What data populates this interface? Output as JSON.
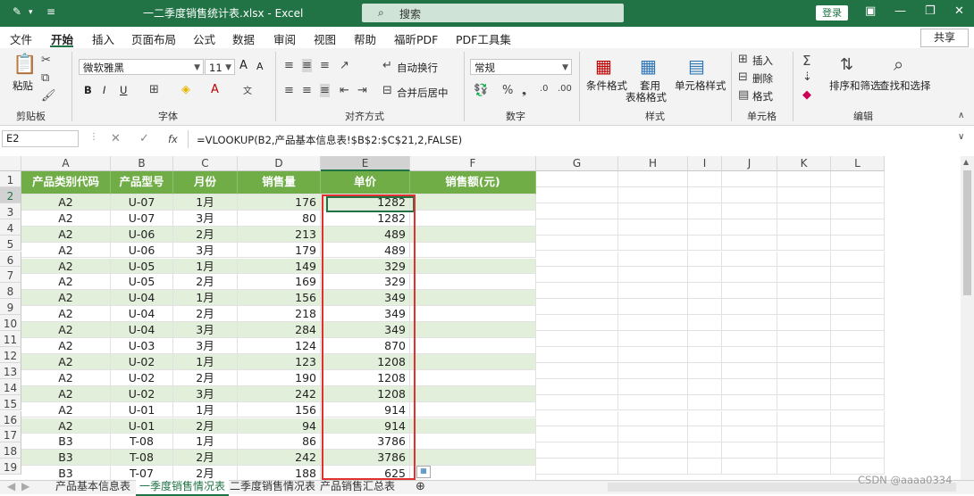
{
  "window": {
    "title": "一二季度销售统计表.xlsx  -  Excel",
    "search_placeholder": "搜索",
    "login": "登录"
  },
  "menu": {
    "items": [
      "文件",
      "开始",
      "插入",
      "页面布局",
      "公式",
      "数据",
      "审阅",
      "视图",
      "帮助",
      "福昕PDF",
      "PDF工具集"
    ],
    "active": "开始",
    "share": "共享"
  },
  "ribbon": {
    "clipboard": {
      "label": "剪贴板",
      "paste": "粘贴"
    },
    "font": {
      "label": "字体",
      "name": "微软雅黑",
      "size": "11",
      "bold": "B",
      "italic": "I",
      "underline": "U",
      "grow": "A",
      "shrink": "A"
    },
    "alignment": {
      "label": "对齐方式",
      "wrap": "自动换行",
      "merge": "合并后居中"
    },
    "number": {
      "label": "数字",
      "format": "常规"
    },
    "styles": {
      "label": "样式",
      "conditional": "条件格式",
      "table1": "套用",
      "table2": "表格格式",
      "cellstyle": "单元格样式"
    },
    "cells": {
      "label": "单元格",
      "insert": "插入",
      "delete": "删除",
      "format": "格式"
    },
    "editing": {
      "label": "编辑",
      "sortfilter": "排序和筛选",
      "findselect": "查找和选择"
    }
  },
  "formula_bar": {
    "name_box": "E2",
    "fx": "fx",
    "formula": "=VLOOKUP(B2,产品基本信息表!$B$2:$C$21,2,FALSE)"
  },
  "grid": {
    "columns": [
      "A",
      "B",
      "C",
      "D",
      "E",
      "F",
      "G",
      "H",
      "I",
      "J",
      "K",
      "L"
    ],
    "row_numbers": [
      "1",
      "2",
      "3",
      "4",
      "5",
      "6",
      "7",
      "8",
      "9",
      "10",
      "11",
      "12",
      "13",
      "14",
      "15",
      "16",
      "17",
      "18",
      "19"
    ],
    "header": [
      "产品类别代码",
      "产品型号",
      "月份",
      "销售量",
      "单价",
      "销售额(元)"
    ],
    "rows": [
      [
        "A2",
        "U-07",
        "1月",
        "176",
        "1282"
      ],
      [
        "A2",
        "U-07",
        "3月",
        "80",
        "1282"
      ],
      [
        "A2",
        "U-06",
        "2月",
        "213",
        "489"
      ],
      [
        "A2",
        "U-06",
        "3月",
        "179",
        "489"
      ],
      [
        "A2",
        "U-05",
        "1月",
        "149",
        "329"
      ],
      [
        "A2",
        "U-05",
        "2月",
        "169",
        "329"
      ],
      [
        "A2",
        "U-04",
        "1月",
        "156",
        "349"
      ],
      [
        "A2",
        "U-04",
        "2月",
        "218",
        "349"
      ],
      [
        "A2",
        "U-04",
        "3月",
        "284",
        "349"
      ],
      [
        "A2",
        "U-03",
        "3月",
        "124",
        "870"
      ],
      [
        "A2",
        "U-02",
        "1月",
        "123",
        "1208"
      ],
      [
        "A2",
        "U-02",
        "2月",
        "190",
        "1208"
      ],
      [
        "A2",
        "U-02",
        "3月",
        "242",
        "1208"
      ],
      [
        "A2",
        "U-01",
        "1月",
        "156",
        "914"
      ],
      [
        "A2",
        "U-01",
        "2月",
        "94",
        "914"
      ],
      [
        "B3",
        "T-08",
        "1月",
        "86",
        "3786"
      ],
      [
        "B3",
        "T-08",
        "2月",
        "242",
        "3786"
      ],
      [
        "B3",
        "T-07",
        "2月",
        "188",
        "625"
      ]
    ]
  },
  "sheets": {
    "tabs": [
      "产品基本信息表",
      "一季度销售情况表",
      "二季度销售情况表",
      "产品销售汇总表"
    ],
    "active": "一季度销售情况表"
  },
  "watermark": "CSDN @aaaa0334"
}
